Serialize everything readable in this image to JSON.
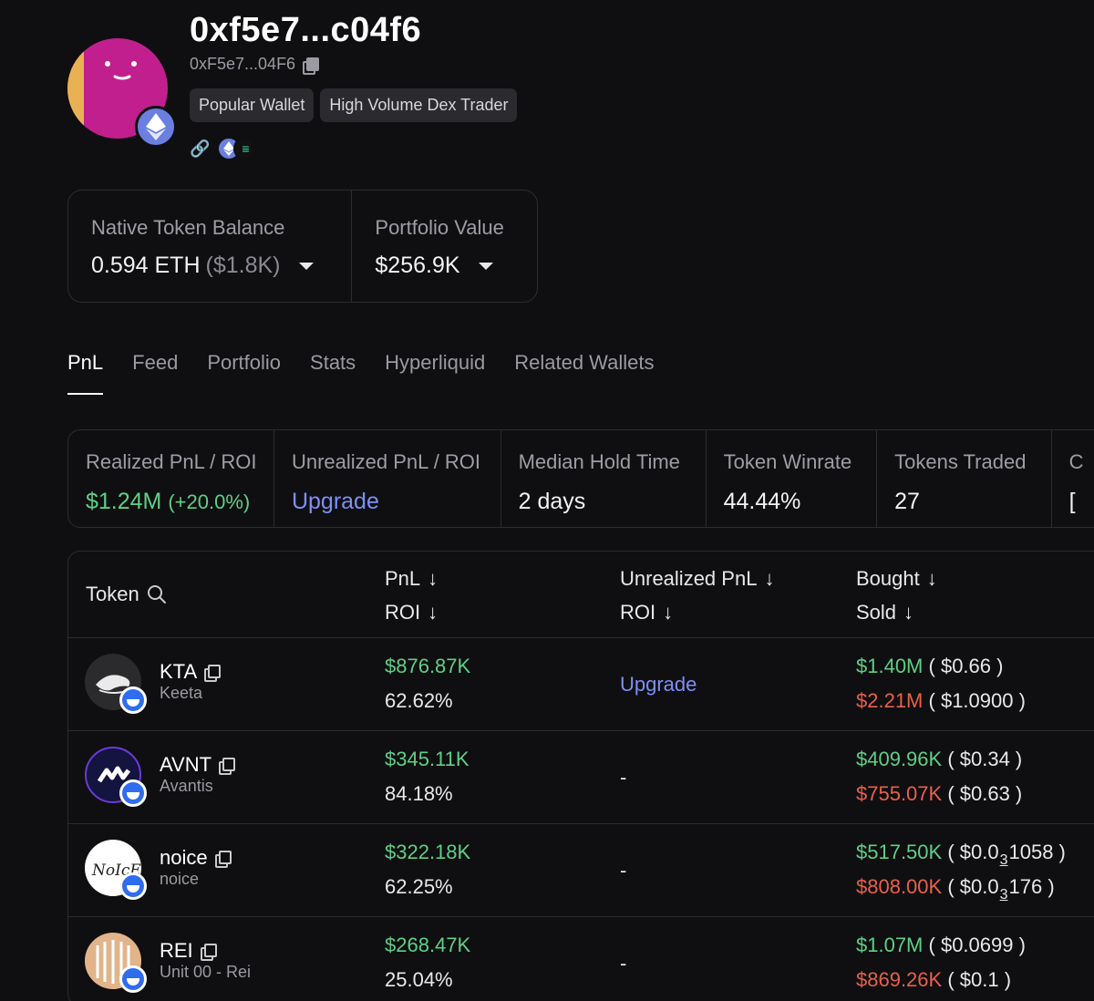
{
  "profile": {
    "title": "0xf5e7...c04f6",
    "address_short": "0xF5e7...04F6",
    "tags": [
      "Popular Wallet",
      "High Volume Dex Trader"
    ],
    "avatar_icon": "smiley-face-icon",
    "chain_icon": "ethereum-icon"
  },
  "balance": {
    "native_label": "Native Token Balance",
    "native_value": "0.594 ETH",
    "native_usd": "($1.8K)",
    "portfolio_label": "Portfolio Value",
    "portfolio_value": "$256.9K"
  },
  "tabs": [
    "PnL",
    "Feed",
    "Portfolio",
    "Stats",
    "Hyperliquid",
    "Related Wallets"
  ],
  "stats": {
    "realized_label": "Realized PnL / ROI",
    "realized_value": "$1.24M",
    "realized_roi": "(+20.0%)",
    "unrealized_label": "Unrealized PnL / ROI",
    "unrealized_value": "Upgrade",
    "hold_label": "Median Hold Time",
    "hold_value": "2 days",
    "winrate_label": "Token Winrate",
    "winrate_value": "44.44%",
    "traded_label": "Tokens Traded",
    "traded_value": "27",
    "next_label": "C",
    "next_value": "["
  },
  "table": {
    "headers": {
      "token": "Token",
      "pnl": "PnL",
      "roi": "ROI",
      "unrealized": "Unrealized PnL",
      "unrealized_roi": "ROI",
      "bought": "Bought",
      "sold": "Sold"
    },
    "rows": [
      {
        "symbol": "KTA",
        "name": "Keeta",
        "pnl": "$876.87K",
        "roi": "62.62%",
        "unrealized": "Upgrade",
        "bought": "$1.40M",
        "bought_price": "( $0.66 )",
        "sold": "$2.21M",
        "sold_price": "( $1.0900 )"
      },
      {
        "symbol": "AVNT",
        "name": "Avantis",
        "pnl": "$345.11K",
        "roi": "84.18%",
        "unrealized": "-",
        "bought": "$409.96K",
        "bought_price": "( $0.34 )",
        "sold": "$755.07K",
        "sold_price": "( $0.63 )"
      },
      {
        "symbol": "noice",
        "name": "noice",
        "pnl": "$322.18K",
        "roi": "62.25%",
        "unrealized": "-",
        "bought": "$517.50K",
        "bought_price_pre": "( $0.0",
        "bought_price_sub": "3",
        "bought_price_post": "1058 )",
        "sold": "$808.00K",
        "sold_price_pre": "( $0.0",
        "sold_price_sub": "3",
        "sold_price_post": "176 )"
      },
      {
        "symbol": "REI",
        "name": "Unit 00 - Rei",
        "pnl": "$268.47K",
        "roi": "25.04%",
        "unrealized": "-",
        "bought": "$1.07M",
        "bought_price": "( $0.0699 )",
        "sold": "$869.26K",
        "sold_price": "( $0.1 )"
      }
    ]
  },
  "colors": {
    "positive": "#5fcf85",
    "negative": "#e8604c",
    "link": "#7e8ff7"
  }
}
